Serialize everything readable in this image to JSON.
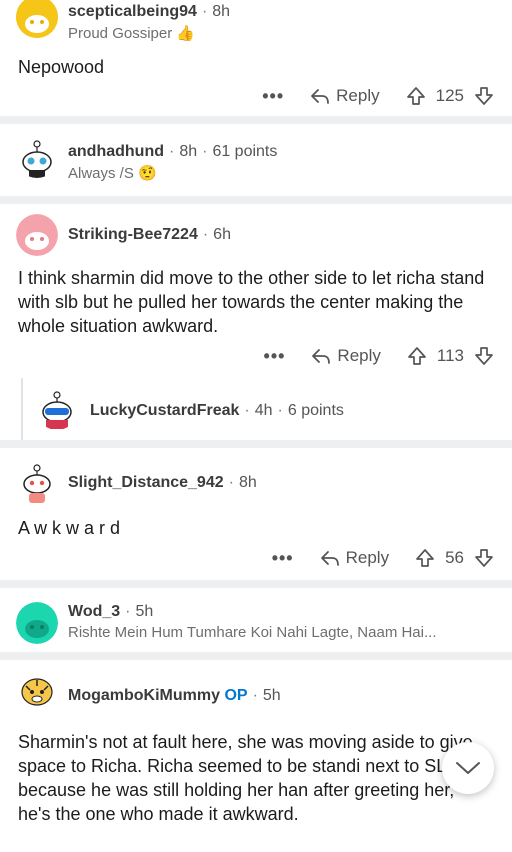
{
  "comments": [
    {
      "user": "scepticalbeing94",
      "time": "8h",
      "flair": "Proud Gossiper 👍",
      "body": "Nepowood",
      "reply_label": "Reply",
      "score": "125",
      "avatar_color": "#f5c518"
    },
    {
      "user": "andhadhund",
      "time": "8h",
      "points": "61 points",
      "flair": "Always /S 🤨"
    },
    {
      "user": "Striking-Bee7224",
      "time": "6h",
      "body": "I think sharmin did move to the other side to let richa stand with slb but he pulled her towards the center making the whole situation awkward.",
      "reply_label": "Reply",
      "score": "113",
      "avatar_color": "#f4a3ad"
    },
    {
      "user": "LuckyCustardFreak",
      "time": "4h",
      "points": "6 points"
    },
    {
      "user": "Slight_Distance_942",
      "time": "8h",
      "body": "A w k w a r d",
      "reply_label": "Reply",
      "score": "56"
    },
    {
      "user": "Wod_3",
      "time": "5h",
      "flair": "Rishte Mein Hum Tumhare Koi Nahi Lagte, Naam Hai...",
      "avatar_color": "#1cd6b0"
    },
    {
      "user": "MogamboKiMummy",
      "op": "OP",
      "time": "5h",
      "body": "Sharmin's not at fault here, she was moving aside to give space to Richa. Richa seemed to be standi next to SLB because he was still holding her han after greeting her, he's the one who made it awkward."
    }
  ],
  "more_label": "•••",
  "dot": "·"
}
